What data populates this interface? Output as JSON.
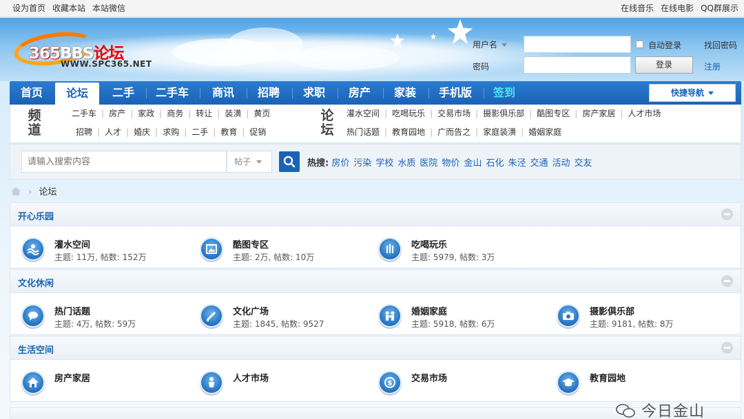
{
  "topbar": {
    "left": [
      "设为首页",
      "收藏本站",
      "本站微信"
    ],
    "right": [
      "在线音乐",
      "在线电影",
      "QQ群展示"
    ]
  },
  "logo": {
    "num": "365",
    "bbs": "BBS",
    "lt": "论坛",
    "url": "WWW.SPC365.NET"
  },
  "login": {
    "username_label": "用户名",
    "password_label": "密码",
    "auto_login": "自动登录",
    "login_button": "登录",
    "find_password": "找回密码",
    "register": "注册"
  },
  "nav": {
    "items": [
      "首页",
      "论坛",
      "二手",
      "二手车",
      "商讯",
      "招聘",
      "求职",
      "房产",
      "家装",
      "手机版",
      "签到"
    ],
    "active": "论坛",
    "quick_nav": "快捷导航"
  },
  "channel": {
    "left_title": "频道",
    "left_rows": [
      [
        "二手车",
        "房产",
        "家政",
        "商务",
        "转让",
        "装潢",
        "黄页"
      ],
      [
        "招聘",
        "人才",
        "婚庆",
        "求购",
        "二手",
        "教育",
        "促销"
      ]
    ],
    "right_title": "论坛",
    "right_rows": [
      [
        "灌水空间",
        "吃喝玩乐",
        "交易市场",
        "摄影俱乐部",
        "酷图专区",
        "房产家居",
        "人才市场"
      ],
      [
        "热门话题",
        "教育园地",
        "广而告之",
        "家庭装潢",
        "婚姻家庭"
      ]
    ]
  },
  "search": {
    "placeholder": "请输入搜索内容",
    "type": "帖子",
    "hot_label": "热搜:",
    "hot": [
      "房价",
      "污染",
      "学校",
      "水质",
      "医院",
      "物价",
      "金山",
      "石化",
      "朱泾",
      "交通",
      "活动",
      "交友"
    ]
  },
  "breadcrumb": {
    "current": "论坛"
  },
  "sections": [
    {
      "title": "开心乐园",
      "forums": [
        {
          "name": "灌水空间",
          "stats": "主题: 11万, 帖数: 152万",
          "icon": "water-icon"
        },
        {
          "name": "酷图专区",
          "stats": "主题: 2万, 帖数: 10万",
          "icon": "picture-icon"
        },
        {
          "name": "吃喝玩乐",
          "stats": "主题: 5979, 帖数: 3万",
          "icon": "food-icon"
        }
      ]
    },
    {
      "title": "文化休闲",
      "forums": [
        {
          "name": "热门话题",
          "stats": "主题: 4万, 帖数: 59万",
          "icon": "chat-icon"
        },
        {
          "name": "文化广场",
          "stats": "主题: 1845, 帖数: 9527",
          "icon": "pen-icon"
        },
        {
          "name": "婚姻家庭",
          "stats": "主题: 5918, 帖数: 6万",
          "icon": "family-icon"
        },
        {
          "name": "摄影俱乐部",
          "stats": "主题: 9181, 帖数: 8万",
          "icon": "camera-icon"
        }
      ]
    },
    {
      "title": "生活空间",
      "forums": [
        {
          "name": "房产家居",
          "stats": "",
          "icon": "house-icon"
        },
        {
          "name": "人才市场",
          "stats": "",
          "icon": "person-icon"
        },
        {
          "name": "交易市场",
          "stats": "",
          "icon": "money-icon"
        },
        {
          "name": "教育园地",
          "stats": "",
          "icon": "graduation-cap-icon"
        }
      ]
    }
  ],
  "watermark": "今日金山",
  "colors": {
    "nav_blue": "#1a63b6",
    "link_blue": "#1a63b6",
    "logo_orange": "#ff7a00",
    "logo_red": "#e00000",
    "sign_cyan": "#48e6f2"
  }
}
